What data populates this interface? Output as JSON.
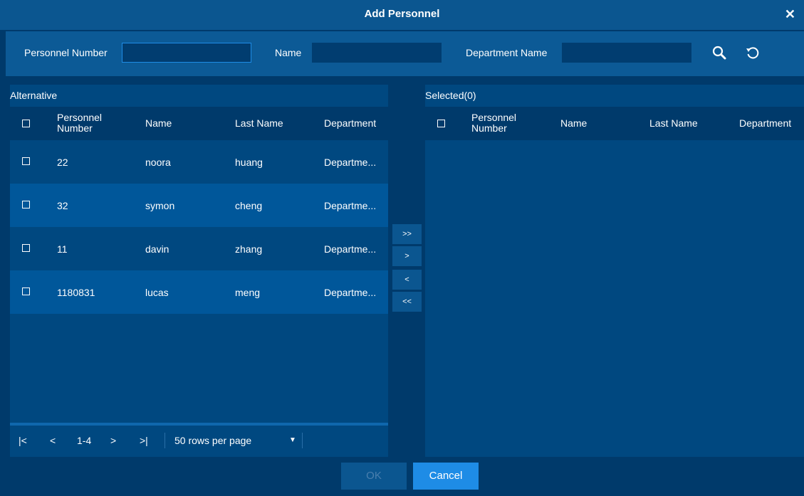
{
  "dialog": {
    "title": "Add Personnel",
    "close_icon": "close-icon"
  },
  "search": {
    "personnel_number_label": "Personnel Number",
    "personnel_number_value": "",
    "name_label": "Name",
    "name_value": "",
    "department_label": "Department Name",
    "department_value": "",
    "search_icon": "search-icon",
    "reset_icon": "refresh-icon"
  },
  "alternative": {
    "heading": "Alternative",
    "columns": [
      "Personnel Number",
      "Name",
      "Last Name",
      "Department"
    ],
    "rows": [
      {
        "number": "22",
        "name": "noora",
        "last_name": "huang",
        "department": "Departme..."
      },
      {
        "number": "32",
        "name": "symon",
        "last_name": "cheng",
        "department": "Departme..."
      },
      {
        "number": "11",
        "name": "davin",
        "last_name": "zhang",
        "department": "Departme..."
      },
      {
        "number": "1180831",
        "name": "lucas",
        "last_name": "meng",
        "department": "Departme..."
      }
    ],
    "pager": {
      "first": "|<",
      "prev": "<",
      "range": "1-4",
      "next": ">",
      "last": ">|",
      "rows_per_page": "50 rows per page"
    }
  },
  "transfer": {
    "move_all_right": ">>",
    "move_right": ">",
    "move_left": "<",
    "move_all_left": "<<"
  },
  "selected": {
    "heading": "Selected(0)",
    "columns": [
      "Personnel Number",
      "Name",
      "Last Name",
      "Department"
    ],
    "rows": []
  },
  "footer": {
    "ok_label": "OK",
    "cancel_label": "Cancel"
  },
  "colors": {
    "background": "#003a6b",
    "panel": "#004880",
    "accent": "#1e8ce6",
    "header": "#0b5690"
  }
}
